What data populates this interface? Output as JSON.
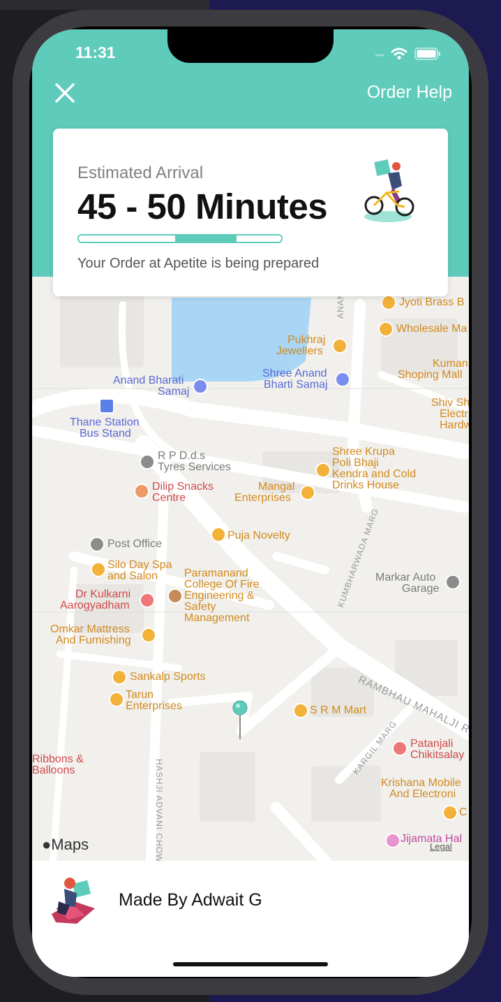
{
  "status_bar": {
    "time": "11:31"
  },
  "header": {
    "order_help": "Order Help"
  },
  "eta_card": {
    "label": "Estimated Arrival",
    "value": "45 - 50 Minutes",
    "progress_fraction": 0.3,
    "status": "Your Order at Apetite is being prepared"
  },
  "map": {
    "places": [
      "Jyoti Brass B",
      "Wholesale Ma",
      "Pukhraj",
      "Jewellers",
      "Kuman",
      "Shoping Mall",
      "Anand Bharati",
      "Samaj",
      "Shree Anand",
      "Bharti Samaj",
      "Shiv Sh",
      "Electr",
      "Hardw",
      "Thane Station",
      "Bus Stand",
      "R P D.d.s",
      "Tyres Services",
      "Shree Krupa",
      "Poli Bhaji",
      "Kendra and Cold",
      "Drinks House",
      "Dilip Snacks",
      "Centre",
      "Mangal",
      "Enterprises",
      "Puja Novelty",
      "Post Office",
      "Silo Day Spa",
      "and Salon",
      "Paramanand",
      "College Of Fire",
      "Engineering &",
      "Safety",
      "Management",
      "Markar Auto",
      "Garage",
      "Dr Kulkarni",
      "Aarogyadham",
      "Omkar Mattress",
      "And Furnishing",
      "Sankalp Sports",
      "Tarun",
      "Enterprises",
      "S R M Mart",
      "Patanjali",
      "Chikitsalay",
      "Ribbons &",
      "Balloons",
      "Krishana Mobile",
      "And Electroni",
      "C",
      "Jijamata Hal"
    ],
    "roads": [
      "ANAND BHARATI MA",
      "KUMBHARWADA MARG",
      "RAMBHAU MAHALJI R",
      "KARGIL MARG",
      "HASHJI ADVANI CHOW"
    ],
    "attribution": "Maps",
    "legal": "Legal"
  },
  "footer": {
    "credit": "Made By Adwait G"
  },
  "colors": {
    "accent": "#5ecbbb",
    "map_background": "#f1f0ec",
    "water": "#a9d6f5"
  },
  "icons": {
    "close": "close-icon",
    "rider": "delivery-rider-icon",
    "pin": "location-pin-icon"
  }
}
